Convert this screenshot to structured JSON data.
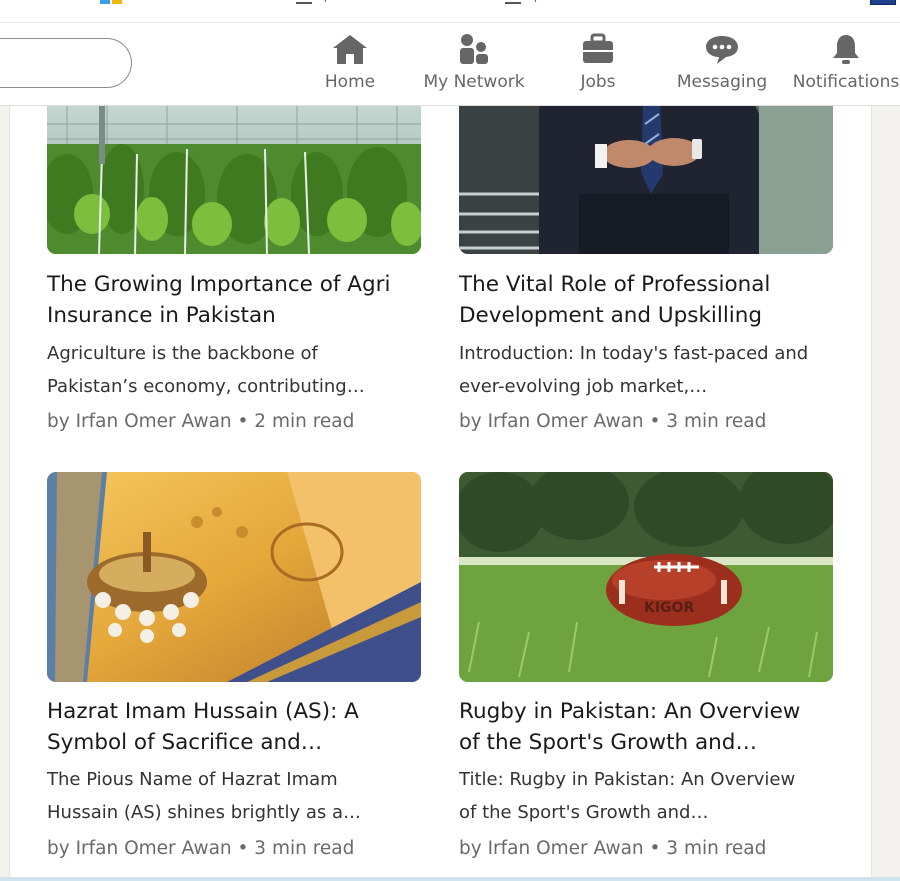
{
  "nav": {
    "items": [
      {
        "label": "Home",
        "icon": "home-icon"
      },
      {
        "label": "My Network",
        "icon": "network-icon"
      },
      {
        "label": "Jobs",
        "icon": "briefcase-icon"
      },
      {
        "label": "Messaging",
        "icon": "message-icon"
      },
      {
        "label": "Notifications",
        "icon": "bell-icon"
      }
    ]
  },
  "articles": [
    {
      "title_lines": [
        "The Growing Importance of Agri",
        "Insurance in Pakistan"
      ],
      "desc_lines": [
        "Agriculture is the backbone of",
        "Pakistan’s economy, contributing…"
      ],
      "meta": "by Irfan Omer Awan • 2 min read"
    },
    {
      "title_lines": [
        "The Vital Role of Professional",
        "Development and Upskilling"
      ],
      "desc_lines": [
        "Introduction: In today's fast-paced and",
        "ever-evolving job market,…"
      ],
      "meta": "by Irfan Omer Awan • 3 min read"
    },
    {
      "title_lines": [
        "Hazrat Imam Hussain (AS): A",
        "Symbol of Sacrifice and…"
      ],
      "desc_lines": [
        "The Pious Name of Hazrat Imam",
        "Hussain (AS) shines brightly as a…"
      ],
      "meta": "by Irfan Omer Awan • 3 min read"
    },
    {
      "title_lines": [
        "Rugby in Pakistan: An Overview",
        "of the Sport's Growth and…"
      ],
      "desc_lines": [
        "Title: Rugby in Pakistan: An Overview",
        "of the Sport's Growth and…"
      ],
      "meta": "by Irfan Omer Awan • 3 min read"
    }
  ]
}
